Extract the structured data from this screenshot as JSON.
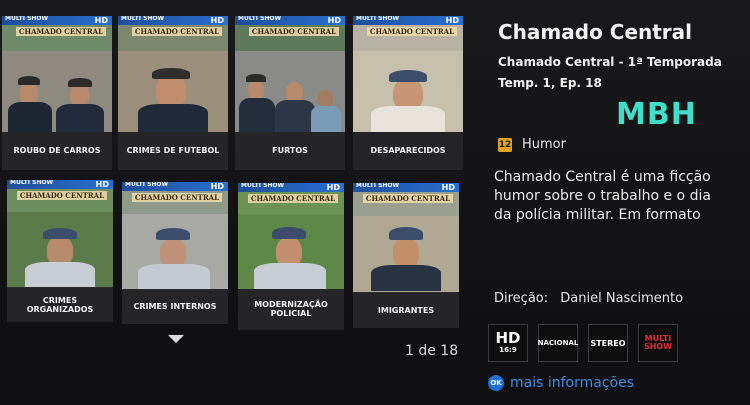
{
  "episodes_grid": {
    "channel_logo": "MULTI SHOW",
    "hd_logo": "HD",
    "brand_text": "CHAMADO CENTRAL",
    "episodes": [
      {
        "caption": "ROUBO DE CARROS"
      },
      {
        "caption": "CRIMES DE FUTEBOL"
      },
      {
        "caption": "FURTOS"
      },
      {
        "caption": "DESAPARECIDOS"
      },
      {
        "caption": "CRIMES ORGANIZADOS"
      },
      {
        "caption": "CRIMES INTERNOS"
      },
      {
        "caption": "MODERNIZAÇÃO POLICIAL"
      },
      {
        "caption": "IMIGRANTES"
      }
    ],
    "page_indicator": "1 de 18",
    "scroll_icon": "chevron-down-icon"
  },
  "details": {
    "title": "Chamado Central",
    "subtitle": "Chamado Central - 1ª Temporada",
    "episode": "Temp. 1, Ep. 18",
    "watermark": "MBH",
    "rating": "12",
    "rating_color": "#e0a51f",
    "genre": "Humor",
    "synopsis_lines": [
      "Chamado Central é uma ficção",
      "humor sobre o trabalho e o dia",
      "da polícia militar.  Em formato"
    ],
    "director_label": "Direção:",
    "director_name": "Daniel Nascimento",
    "badges": {
      "hd_big": "HD",
      "hd_small": "16:9",
      "audio": "NACIONAL",
      "sound": "STEREO",
      "channel_line1": "MULTI",
      "channel_line2": "SHOW"
    },
    "more_button_key": "OK",
    "more_info_label": "mais informações",
    "accent_color": "#3d8fe6"
  }
}
